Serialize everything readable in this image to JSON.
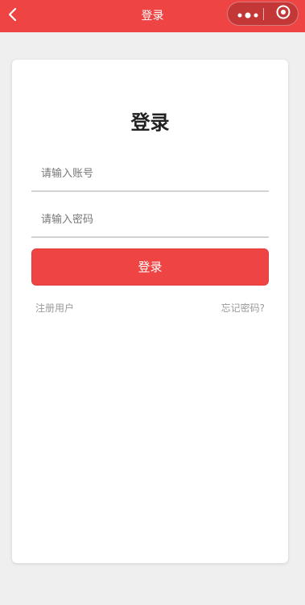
{
  "navbar": {
    "title": "登录",
    "back_icon": "chevron-left-icon",
    "more_icon": "more-dots-icon",
    "close_icon": "target-circle-icon",
    "background_color": "#ee4443"
  },
  "login_card": {
    "title": "登录",
    "account_placeholder": "请输入账号",
    "account_value": "",
    "password_placeholder": "请输入密码",
    "password_value": "",
    "login_button_label": "登录",
    "register_link": "注册用户",
    "forgot_link": "忘记密码?"
  },
  "colors": {
    "accent": "#ee4443",
    "page_background": "#efefef",
    "link_text": "#9a9a9a"
  }
}
